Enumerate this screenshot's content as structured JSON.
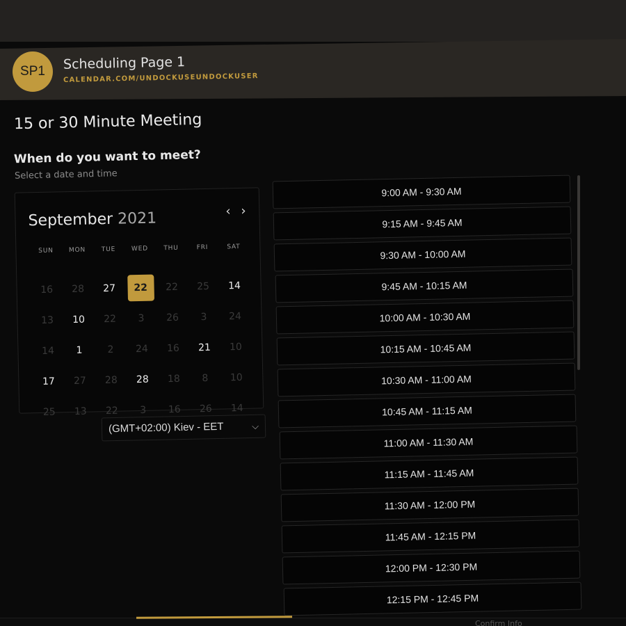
{
  "header": {
    "avatar_initials": "SP1",
    "title": "Scheduling Page 1",
    "link": "CALENDAR.COM/UNDOCKUSEUNDOCKUSER",
    "accent": "#c19a3d"
  },
  "page_title": "15 or 30 Minute Meeting",
  "question": "When do you want to meet?",
  "subtitle": "Select a date and time",
  "calendar": {
    "month": "September",
    "year": "2021",
    "prev_icon": "‹",
    "next_icon": "›",
    "weekdays": [
      "SUN",
      "MON",
      "TUE",
      "WED",
      "THU",
      "FRI",
      "SAT"
    ],
    "weeks": [
      [
        "16",
        "28",
        "27",
        "22",
        "22",
        "25",
        "14"
      ],
      [
        "13",
        "10",
        "22",
        "3",
        "26",
        "3",
        "24"
      ],
      [
        "14",
        "1",
        "2",
        "24",
        "16",
        "21",
        "10"
      ],
      [
        "17",
        "27",
        "28",
        "28",
        "18",
        "8",
        "10"
      ],
      [
        "25",
        "13",
        "22",
        "3",
        "16",
        "26",
        "14"
      ]
    ],
    "selected": "22"
  },
  "timezone": {
    "value": "(GMT+02:00) Kiev - EET",
    "icon": "chevron-down-icon"
  },
  "slots": [
    "9:00 AM - 9:30 AM",
    "9:15 AM - 9:45 AM",
    "9:30 AM - 10:00 AM",
    "9:45 AM - 10:15 AM",
    "10:00 AM - 10:30 AM",
    "10:15 AM - 10:45 AM",
    "10:30 AM - 11:00 AM",
    "10:45 AM - 11:15 AM",
    "11:00 AM - 11:30 AM",
    "11:15 AM - 11:45 AM",
    "11:30 AM - 12:00 PM",
    "11:45 AM - 12:15 PM",
    "12:00 PM - 12:30 PM",
    "12:15 PM - 12:45 PM"
  ],
  "footer": {
    "next_step": "Confirm Info"
  }
}
